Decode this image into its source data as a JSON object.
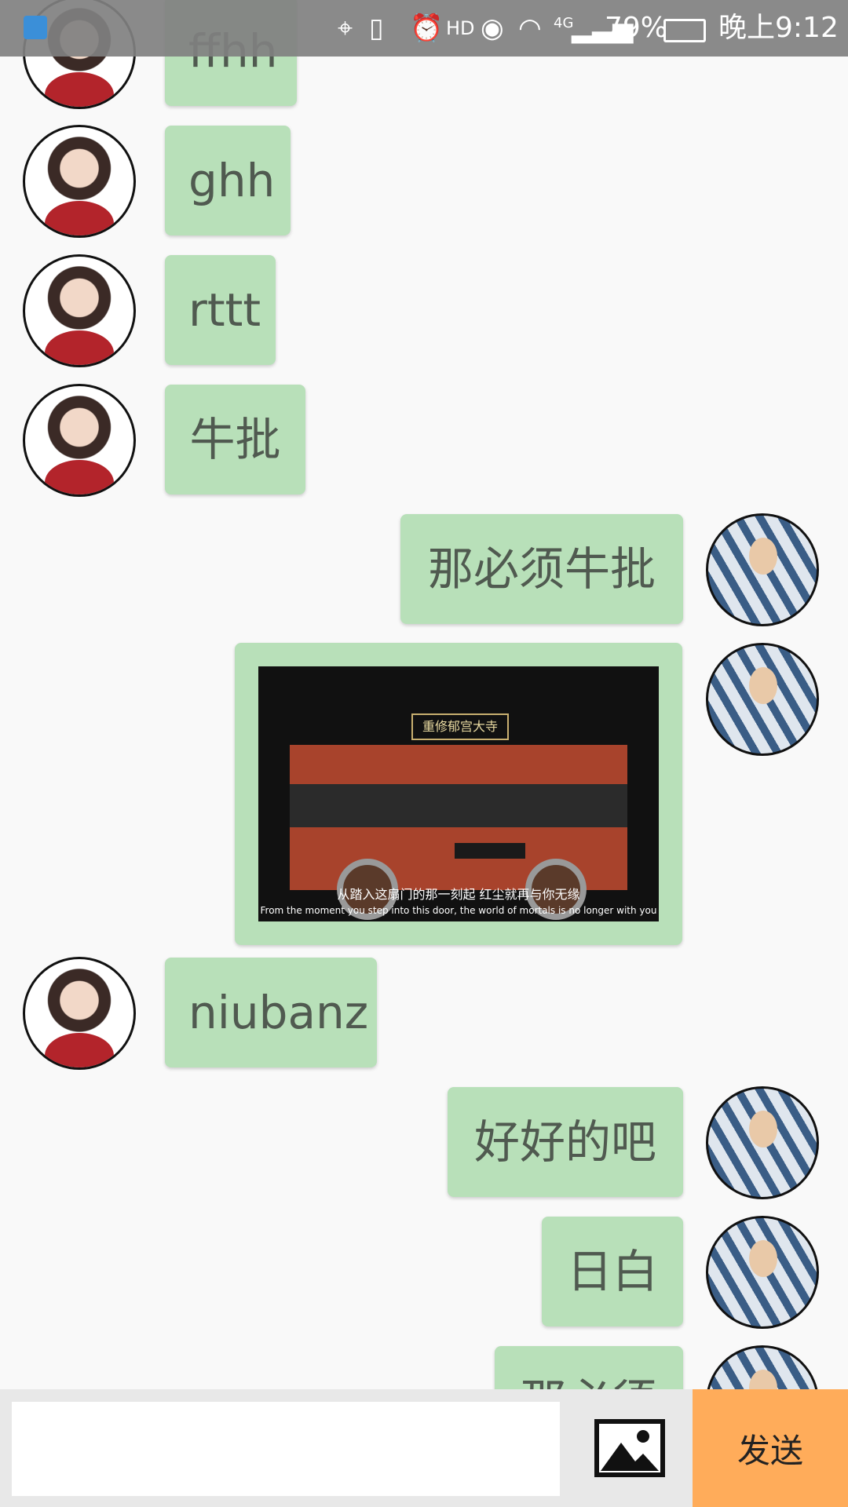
{
  "status_bar": {
    "battery": "79%",
    "time": "晚上9:12",
    "network": "4G",
    "hd": "HD"
  },
  "messages": [
    {
      "side": "left",
      "text": "ffhh"
    },
    {
      "side": "left",
      "text": "ghh"
    },
    {
      "side": "left",
      "text": "rttt"
    },
    {
      "side": "left",
      "text": "牛批"
    },
    {
      "side": "right",
      "text": "那必须牛批"
    },
    {
      "side": "right",
      "type": "image",
      "caption_cn": "从踏入这扇门的那一刻起 红尘就再与你无缘",
      "caption_en": "From the moment you step into this door, the world of mortals is no longer with you",
      "sign": "重修郁宫大寺"
    },
    {
      "side": "left",
      "text": "niubanz"
    },
    {
      "side": "right",
      "text": "好好的吧"
    },
    {
      "side": "right",
      "text": "日白"
    },
    {
      "side": "right",
      "text": "那必须"
    }
  ],
  "composer": {
    "input_value": "",
    "send_label": "发送"
  },
  "colors": {
    "bubble": "#b8e0b9",
    "send_button": "#ffac5a",
    "status_bar": "#808080"
  }
}
